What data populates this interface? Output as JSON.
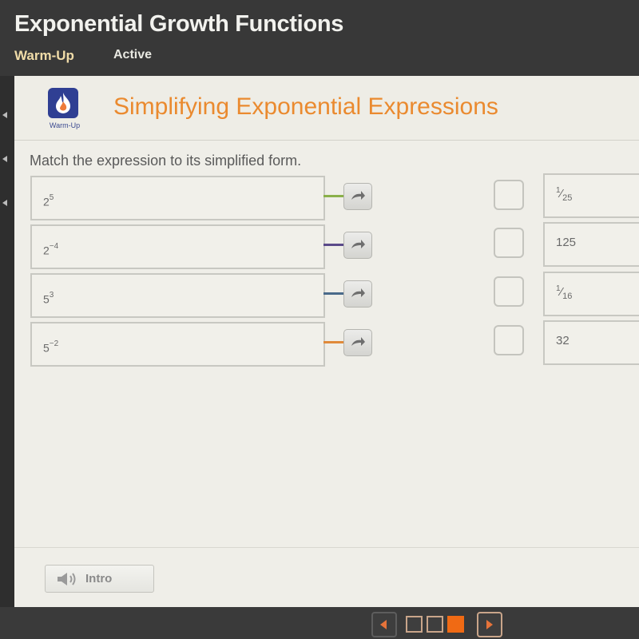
{
  "header": {
    "title": "Exponential Growth Functions",
    "tabs": [
      {
        "label": "Warm-Up"
      },
      {
        "label": "Active"
      }
    ]
  },
  "lesson": {
    "badge_label": "Warm-Up",
    "badge_icon": "flame-icon",
    "title": "Simplifying Exponential Expressions",
    "brand_color": "#ea8a2f"
  },
  "activity": {
    "instruction": "Match the expression to its simplified form.",
    "expressions": [
      {
        "base": "2",
        "exponent": "5",
        "connector_color": "#8ab04a"
      },
      {
        "base": "2",
        "exponent": "−4",
        "connector_color": "#5b4a8a"
      },
      {
        "base": "5",
        "exponent": "3",
        "connector_color": "#4a6a8a"
      },
      {
        "base": "5",
        "exponent": "−2",
        "connector_color": "#e08a3a"
      }
    ],
    "answers": [
      {
        "num": "1",
        "den": "25",
        "text": null
      },
      {
        "num": null,
        "den": null,
        "text": "125"
      },
      {
        "num": "1",
        "den": "16",
        "text": null
      },
      {
        "num": null,
        "den": null,
        "text": "32"
      }
    ]
  },
  "footer": {
    "intro_label": "Intro",
    "pagination": {
      "total": 3,
      "current": 3
    }
  }
}
